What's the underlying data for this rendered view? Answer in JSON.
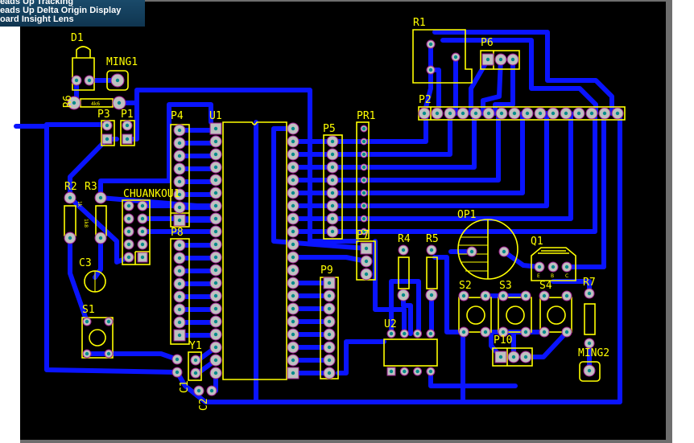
{
  "overlay": {
    "lines": [
      "Heads Up Tracking",
      "Heads Up Delta Origin Display",
      "Board Insight Lens"
    ]
  },
  "colors": {
    "board": "#000000",
    "trace": "#0a14ff",
    "silkscreen": "#ffff00",
    "pad": "#c0c0c0",
    "pad_hole": "#008b8b"
  },
  "components": {
    "D1": "D1",
    "MING1": "MING1",
    "R6": "R6",
    "P3": "P3",
    "P1": "P1",
    "P4": "P4",
    "U1": "U1",
    "P5": "P5",
    "PR1": "PR1",
    "R1": "R1",
    "P6": "P6",
    "P2": "P2",
    "R2": "R2",
    "R3": "R3",
    "CHUANKOU1": "CHUANKOU1",
    "P8": "P8",
    "C3": "C3",
    "S1": "S1",
    "Y1": "Y1",
    "C1": "C1",
    "C2": "C2",
    "P9": "P9",
    "P7": "P7",
    "R4": "R4",
    "R5": "R5",
    "OP1": "OP1",
    "Q1": "Q1",
    "S2": "S2",
    "S3": "S3",
    "S4": "S4",
    "R7": "R7",
    "MING2": "MING2",
    "P10": "P10",
    "U2": "U2"
  },
  "values": {
    "R6": "4k6",
    "R2": "1k",
    "R3": "1k8"
  },
  "q1_pins": [
    "E",
    "B",
    "C"
  ]
}
